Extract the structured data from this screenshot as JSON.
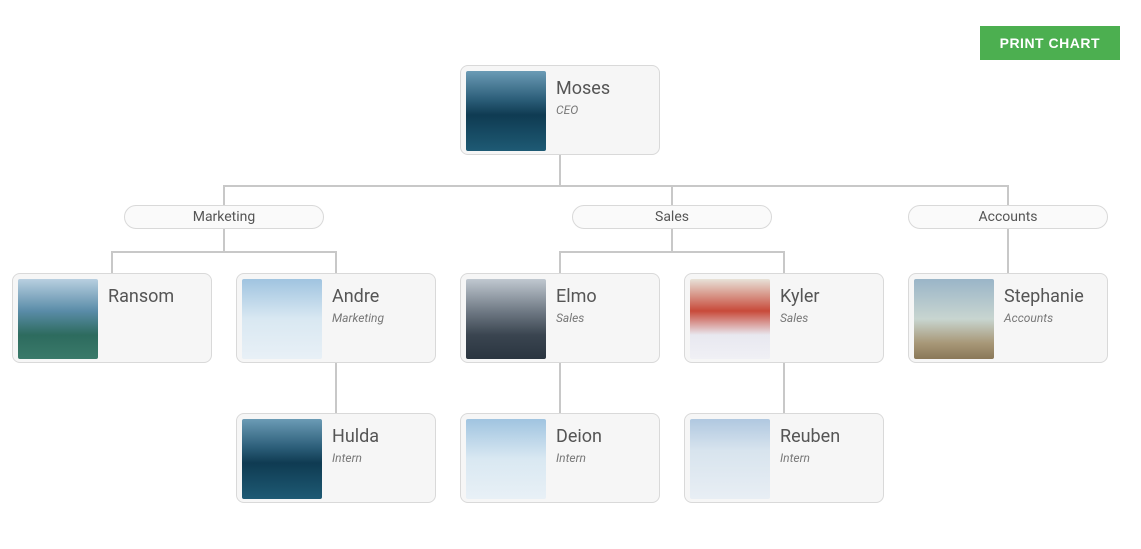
{
  "print_button_label": "PRINT CHART",
  "departments": {
    "marketing": "Marketing",
    "sales": "Sales",
    "accounts": "Accounts"
  },
  "people": {
    "ceo": {
      "name": "Moses",
      "title": "CEO"
    },
    "ransom": {
      "name": "Ransom",
      "title": ""
    },
    "andre": {
      "name": "Andre",
      "title": "Marketing"
    },
    "elmo": {
      "name": "Elmo",
      "title": "Sales"
    },
    "kyler": {
      "name": "Kyler",
      "title": "Sales"
    },
    "stephanie": {
      "name": "Stephanie",
      "title": "Accounts"
    },
    "hulda": {
      "name": "Hulda",
      "title": "Intern"
    },
    "deion": {
      "name": "Deion",
      "title": "Intern"
    },
    "reuben": {
      "name": "Reuben",
      "title": "Intern"
    }
  }
}
